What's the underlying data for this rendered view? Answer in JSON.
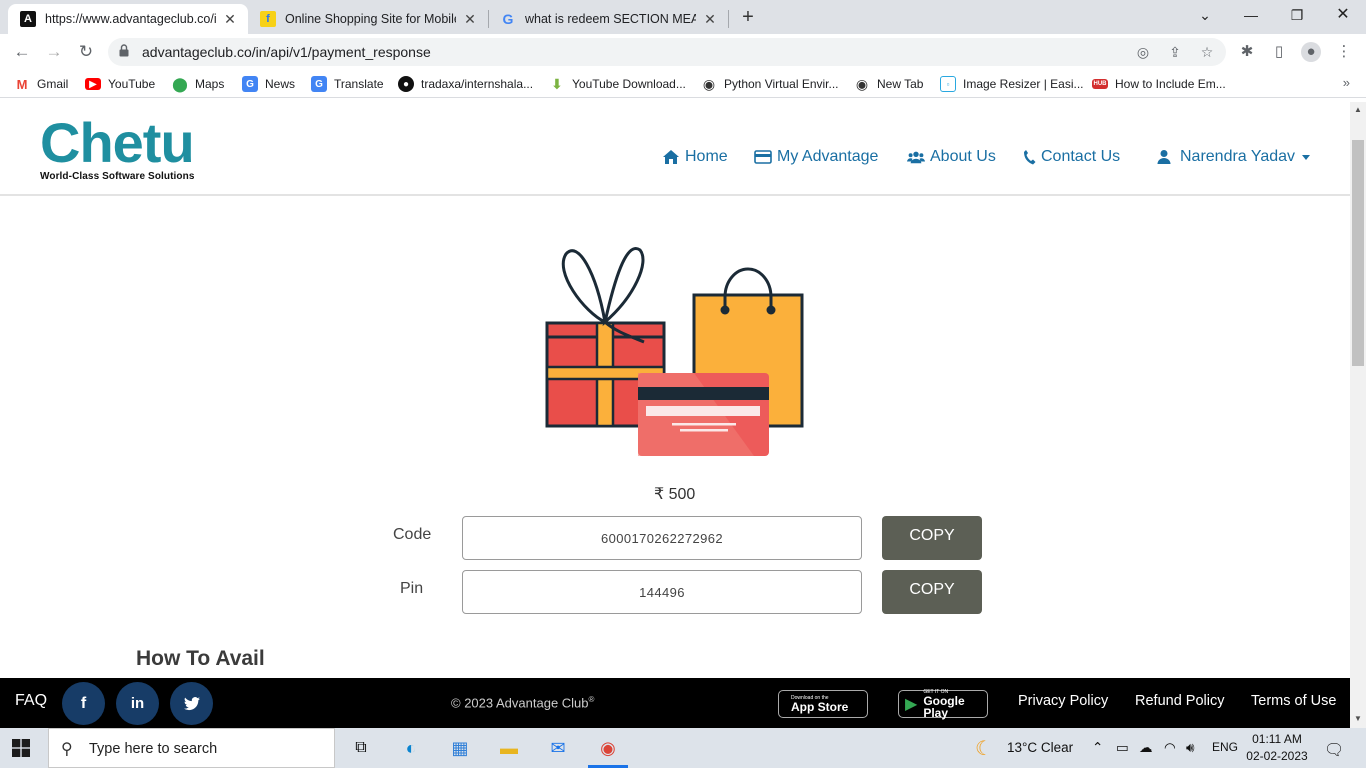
{
  "browser": {
    "tabs": [
      {
        "title": "https://www.advantageclub.co/in",
        "active": true,
        "favicon": "advantage-a-icon"
      },
      {
        "title": "Online Shopping Site for Mobiles",
        "active": false,
        "favicon": "flipkart-icon"
      },
      {
        "title": "what is redeem SECTION MEANS",
        "active": false,
        "favicon": "google-icon"
      }
    ],
    "url": "advantageclub.co/in/api/v1/payment_response",
    "bookmarks": [
      {
        "label": "Gmail",
        "icon": "gmail-icon",
        "color": "#ea4335"
      },
      {
        "label": "YouTube",
        "icon": "youtube-icon",
        "color": "#ff0000"
      },
      {
        "label": "Maps",
        "icon": "maps-icon",
        "color": "#34a853"
      },
      {
        "label": "News",
        "icon": "news-icon",
        "color": "#4285f4"
      },
      {
        "label": "Translate",
        "icon": "translate-icon",
        "color": "#4285f4"
      },
      {
        "label": "tradaxa/internshala...",
        "icon": "github-icon",
        "color": "#111111"
      },
      {
        "label": "YouTube Download...",
        "icon": "download-icon",
        "color": "#7cb342"
      },
      {
        "label": "Python Virtual Envir...",
        "icon": "globe-icon",
        "color": "#333333"
      },
      {
        "label": "New Tab",
        "icon": "globe-icon",
        "color": "#333333"
      },
      {
        "label": "Image Resizer | Easi...",
        "icon": "image-resizer-icon",
        "color": "#29a8e0"
      },
      {
        "label": "How to Include Em...",
        "icon": "hub-icon",
        "color": "#d32f2f"
      }
    ]
  },
  "site": {
    "logo_word": "Chetu",
    "logo_tagline": "World-Class Software Solutions",
    "nav": {
      "home": "Home",
      "my_advantage": "My Advantage",
      "about": "About Us",
      "contact": "Contact Us",
      "user": "Narendra Yadav"
    },
    "amount": "₹ 500",
    "code_label": "Code",
    "code_value": "6000170262272962",
    "pin_label": "Pin",
    "pin_value": "144496",
    "copy_label": "COPY",
    "how_to_avail": "How To Avail",
    "footer": {
      "faq": "FAQ",
      "copyright": "© 2023 Advantage Club",
      "copyright_mark": "®",
      "app_store_small": "Download on the",
      "app_store": "App Store",
      "google_play_small": "GET IT ON",
      "google_play": "Google Play",
      "privacy": "Privacy Policy",
      "refund": "Refund Policy",
      "terms": "Terms of Use"
    }
  },
  "taskbar": {
    "search_placeholder": "Type here to search",
    "weather": "13°C  Clear",
    "language": "ENG",
    "time": "01:11 AM",
    "date": "02-02-2023"
  },
  "colors": {
    "brand_teal": "#1f8fa0",
    "nav_blue": "#1a6fa3",
    "copy_button": "#5c5f55",
    "footer_bg": "#000000",
    "social_bg": "#173c67"
  }
}
